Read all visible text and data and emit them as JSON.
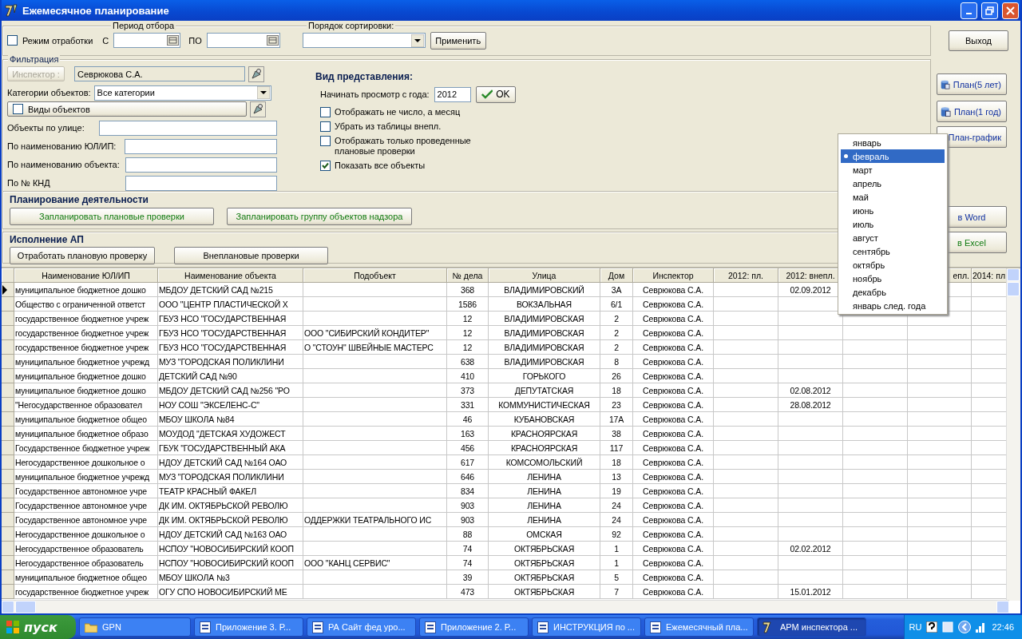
{
  "window": {
    "title": "Ежемесячное планирование"
  },
  "period": {
    "legend": "Период отбора",
    "mode_checkbox": {
      "label": "Режим отработки",
      "checked": false
    },
    "from_label": "С",
    "to_label": "ПО"
  },
  "sort": {
    "legend": "Порядок сортировки:",
    "apply_button": "Применить"
  },
  "exit_button": "Выход",
  "filter": {
    "legend": "Фильтрация",
    "inspector_button": {
      "label": "Инспектор :",
      "disabled": true
    },
    "inspector_value": "Севрюкова С.А.",
    "categories_label": "Категории объектов:",
    "categories_value": "Все категории",
    "kinds_checkbox": {
      "label": "Виды объектов",
      "checked": false
    },
    "fields": [
      {
        "label": "Объекты по улице:"
      },
      {
        "label": "По наименованию ЮЛ/ИП:"
      },
      {
        "label": "По наименованию объекта:"
      },
      {
        "label": "По № КНД"
      }
    ]
  },
  "view": {
    "title": "Вид представления:",
    "year_label": "Начинать просмотр с года:",
    "year_value": "2012",
    "ok_button": "OK",
    "options": [
      {
        "label": "Отображать не число, а месяц",
        "checked": false
      },
      {
        "label": "Убрать из таблицы внепл.",
        "checked": false
      },
      {
        "label": "Отображать только проведенные плановые проверки",
        "checked": false
      },
      {
        "label": "Показать все объекты",
        "checked": true
      }
    ]
  },
  "planning": {
    "title": "Планирование деятельности",
    "buttons": [
      "Запланировать плановые проверки",
      "Запланировать группу объектов надзора"
    ]
  },
  "execution": {
    "title": "Исполнение АП",
    "buttons": [
      "Отработать плановую проверку",
      "Внеплановые проверки"
    ]
  },
  "side_buttons": [
    {
      "label": "План(5 лет)",
      "kind": "icon"
    },
    {
      "label": "План(1 год)",
      "kind": "icon"
    },
    {
      "label": "План-график",
      "kind": "icon"
    },
    {
      "label": "в Word",
      "kind": "word"
    },
    {
      "label": "в Excel",
      "kind": "excel"
    }
  ],
  "month_menu": [
    {
      "label": "январь",
      "selected": false
    },
    {
      "label": "февраль",
      "selected": true
    },
    {
      "label": "март",
      "selected": false
    },
    {
      "label": "апрель",
      "selected": false
    },
    {
      "label": "май",
      "selected": false
    },
    {
      "label": "июнь",
      "selected": false
    },
    {
      "label": "июль",
      "selected": false
    },
    {
      "label": "август",
      "selected": false
    },
    {
      "label": "сентябрь",
      "selected": false
    },
    {
      "label": "октябрь",
      "selected": false
    },
    {
      "label": "ноябрь",
      "selected": false
    },
    {
      "label": "декабрь",
      "selected": false
    },
    {
      "label": "январь след. года",
      "selected": false
    }
  ],
  "table": {
    "columns": [
      "Наименование ЮЛ/ИП",
      "Наименование объекта",
      "Подобъект",
      "№ дела",
      "Улица",
      "Дом",
      "Инспектор",
      "2012: пл.",
      "2012: внепл.",
      "епл.",
      "2014: пл"
    ],
    "rows": [
      {
        "current": true,
        "name": "муниципальное бюджетное дошко",
        "object": "МБДОУ ДЕТСКИЙ САД №215",
        "case_no": "368",
        "street": "ВЛАДИМИРОВСКИЙ",
        "house": "3А",
        "inspector": "Севрюкова С.А.",
        "unplanned_2012": "02.09.2012"
      },
      {
        "current": false,
        "name": "Общество с ограниченной ответст",
        "object": "ООО \"ЦЕНТР ПЛАСТИЧЕСКОЙ Х",
        "case_no": "1586",
        "street": "ВОКЗАЛЬНАЯ",
        "house": "6/1",
        "inspector": "Севрюкова С.А."
      },
      {
        "current": false,
        "name": "государственное бюджетное учреж",
        "object": "ГБУЗ НСО \"ГОСУДАРСТВЕННАЯ",
        "case_no": "12",
        "street": "ВЛАДИМИРОВСКАЯ",
        "house": "2",
        "inspector": "Севрюкова С.А."
      },
      {
        "current": false,
        "name": "государственное бюджетное учреж",
        "object": "ГБУЗ НСО \"ГОСУДАРСТВЕННАЯ",
        "subobject": "ООО \"СИБИРСКИЙ КОНДИТЕР\"",
        "case_no": "12",
        "street": "ВЛАДИМИРОВСКАЯ",
        "house": "2",
        "inspector": "Севрюкова С.А."
      },
      {
        "current": false,
        "name": "государственное бюджетное учреж",
        "object": "ГБУЗ НСО \"ГОСУДАРСТВЕННАЯ",
        "subobject": "О \"СТОУН\" ШВЕЙНЫЕ МАСТЕРС",
        "case_no": "12",
        "street": "ВЛАДИМИРОВСКАЯ",
        "house": "2",
        "inspector": "Севрюкова С.А."
      },
      {
        "current": false,
        "name": "муниципальное бюджетное учрежд",
        "object": "МУЗ \"ГОРОДСКАЯ ПОЛИКЛИНИ",
        "case_no": "638",
        "street": "ВЛАДИМИРОВСКАЯ",
        "house": "8",
        "inspector": "Севрюкова С.А."
      },
      {
        "current": false,
        "name": "муниципальное бюджетное дошко",
        "object": "ДЕТСКИЙ САД №90",
        "case_no": "410",
        "street": "ГОРЬКОГО",
        "house": "26",
        "inspector": "Севрюкова С.А."
      },
      {
        "current": false,
        "name": "муниципальное бюджетное дошко",
        "object": "МБДОУ ДЕТСКИЙ САД №256 \"РО",
        "case_no": "373",
        "street": "ДЕПУТАТСКАЯ",
        "house": "18",
        "inspector": "Севрюкова С.А.",
        "unplanned_2012": "02.08.2012"
      },
      {
        "current": false,
        "name": "\"Негосударственное образовател",
        "object": "НОУ СОШ \"ЭКСЕЛЕНС-С\"",
        "case_no": "331",
        "street": "КОММУНИСТИЧЕСКАЯ",
        "house": "23",
        "inspector": "Севрюкова С.А.",
        "unplanned_2012": "28.08.2012"
      },
      {
        "current": false,
        "name": "муниципальное бюджетное общео",
        "object": "МБОУ ШКОЛА №84",
        "case_no": "46",
        "street": "КУБАНОВСКАЯ",
        "house": "17А",
        "inspector": "Севрюкова С.А."
      },
      {
        "current": false,
        "name": "муниципальное бюджетное образо",
        "object": "МОУДОД \"ДЕТСКАЯ ХУДОЖЕСТ",
        "case_no": "163",
        "street": "КРАСНОЯРСКАЯ",
        "house": "38",
        "inspector": "Севрюкова С.А."
      },
      {
        "current": false,
        "name": "Государственное бюджетное учреж",
        "object": "ГБУК \"ГОСУДАРСТВЕННЫЙ АКА",
        "case_no": "456",
        "street": "КРАСНОЯРСКАЯ",
        "house": "117",
        "inspector": "Севрюкова С.А."
      },
      {
        "current": false,
        "name": "Негосударственное дошкольное о",
        "object": "НДОУ ДЕТСКИЙ САД №164 ОАО",
        "case_no": "617",
        "street": "КОМСОМОЛЬСКИЙ",
        "house": "18",
        "inspector": "Севрюкова С.А."
      },
      {
        "current": false,
        "name": "муниципальное бюджетное учрежд",
        "object": "МУЗ \"ГОРОДСКАЯ ПОЛИКЛИНИ",
        "case_no": "646",
        "street": "ЛЕНИНА",
        "house": "13",
        "inspector": "Севрюкова С.А."
      },
      {
        "current": false,
        "name": "Государственное автономное учре",
        "object": "ТЕАТР КРАСНЫЙ ФАКЕЛ",
        "case_no": "834",
        "street": "ЛЕНИНА",
        "house": "19",
        "inspector": "Севрюкова С.А."
      },
      {
        "current": false,
        "name": "Государственное автономное учре",
        "object": "ДК ИМ. ОКТЯБРЬСКОЙ РЕВОЛЮ",
        "case_no": "903",
        "street": "ЛЕНИНА",
        "house": "24",
        "inspector": "Севрюкова С.А."
      },
      {
        "current": false,
        "name": "Государственное автономное учре",
        "object": "ДК ИМ. ОКТЯБРЬСКОЙ РЕВОЛЮ",
        "subobject": "ОДДЕРЖКИ ТЕАТРАЛЬНОГО ИС",
        "case_no": "903",
        "street": "ЛЕНИНА",
        "house": "24",
        "inspector": "Севрюкова С.А."
      },
      {
        "current": false,
        "name": "Негосударственное дошкольное о",
        "object": "НДОУ ДЕТСКИЙ САД №163 ОАО",
        "case_no": "88",
        "street": "ОМСКАЯ",
        "house": "92",
        "inspector": "Севрюкова С.А."
      },
      {
        "current": false,
        "name": "Негосударственное образователь",
        "object": "НСПОУ \"НОВОСИБИРСКИЙ КООП",
        "case_no": "74",
        "street": "ОКТЯБРЬСКАЯ",
        "house": "1",
        "inspector": "Севрюкова С.А.",
        "unplanned_2012": "02.02.2012"
      },
      {
        "current": false,
        "name": "Негосударственное образователь",
        "object": "НСПОУ \"НОВОСИБИРСКИЙ КООП",
        "subobject": "ООО \"КАНЦ СЕРВИС\"",
        "case_no": "74",
        "street": "ОКТЯБРЬСКАЯ",
        "house": "1",
        "inspector": "Севрюкова С.А."
      },
      {
        "current": false,
        "name": "муниципальное бюджетное общео",
        "object": "МБОУ ШКОЛА №3",
        "case_no": "39",
        "street": "ОКТЯБРЬСКАЯ",
        "house": "5",
        "inspector": "Севрюкова С.А."
      },
      {
        "current": false,
        "name": "государственное бюджетное учреж",
        "object": "ОГУ СПО НОВОСИБИРСКИЙ МЕ",
        "case_no": "473",
        "street": "ОКТЯБРЬСКАЯ",
        "house": "7",
        "inspector": "Севрюкова С.А.",
        "unplanned_2012": "15.01.2012"
      }
    ]
  },
  "taskbar": {
    "start_label": "пуск",
    "tasks": [
      {
        "label": "GPN",
        "kind": "folder",
        "selected": false
      },
      {
        "label": "Приложение 3. Р...",
        "kind": "document",
        "selected": false
      },
      {
        "label": "РА Сайт фед уро...",
        "kind": "document",
        "selected": false
      },
      {
        "label": "Приложение 2. Р...",
        "kind": "document",
        "selected": false
      },
      {
        "label": "ИНСТРУКЦИЯ по ...",
        "kind": "document",
        "selected": false
      },
      {
        "label": "Ежемесячный пла...",
        "kind": "document",
        "selected": false
      },
      {
        "label": "АРМ инспектора ...",
        "kind": "app",
        "selected": true
      }
    ],
    "language": "RU",
    "clock": "22:46"
  }
}
